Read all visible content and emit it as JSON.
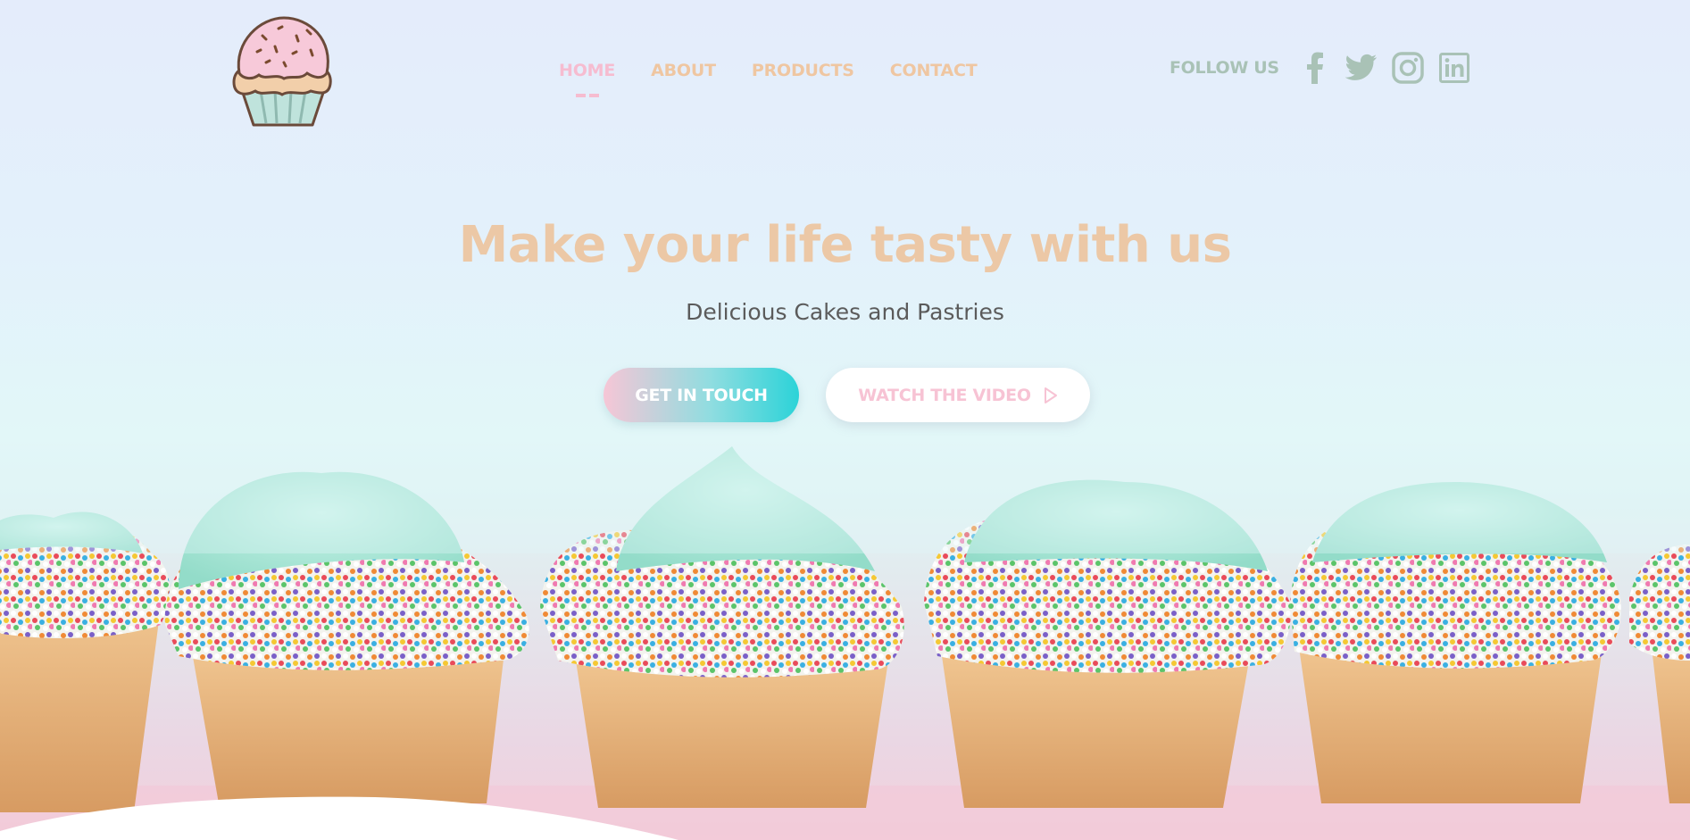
{
  "nav": {
    "items": [
      {
        "label": "HOME",
        "active": true
      },
      {
        "label": "ABOUT",
        "active": false
      },
      {
        "label": "PRODUCTS",
        "active": false
      },
      {
        "label": "CONTACT",
        "active": false
      }
    ]
  },
  "follow": {
    "label": "FOLLOW US",
    "icons": [
      "facebook-icon",
      "twitter-icon",
      "instagram-icon",
      "linkedin-icon"
    ]
  },
  "hero": {
    "title": "Make your life tasty with us",
    "subtitle": "Delicious Cakes and Pastries",
    "primary_button": "GET IN TOUCH",
    "secondary_button": "WATCH THE VIDEO"
  },
  "colors": {
    "accent_pink": "#f6bcd0",
    "accent_peach": "#ecc8a6",
    "accent_teal": "#2bd3d8",
    "social_green": "#a9c2b6"
  }
}
